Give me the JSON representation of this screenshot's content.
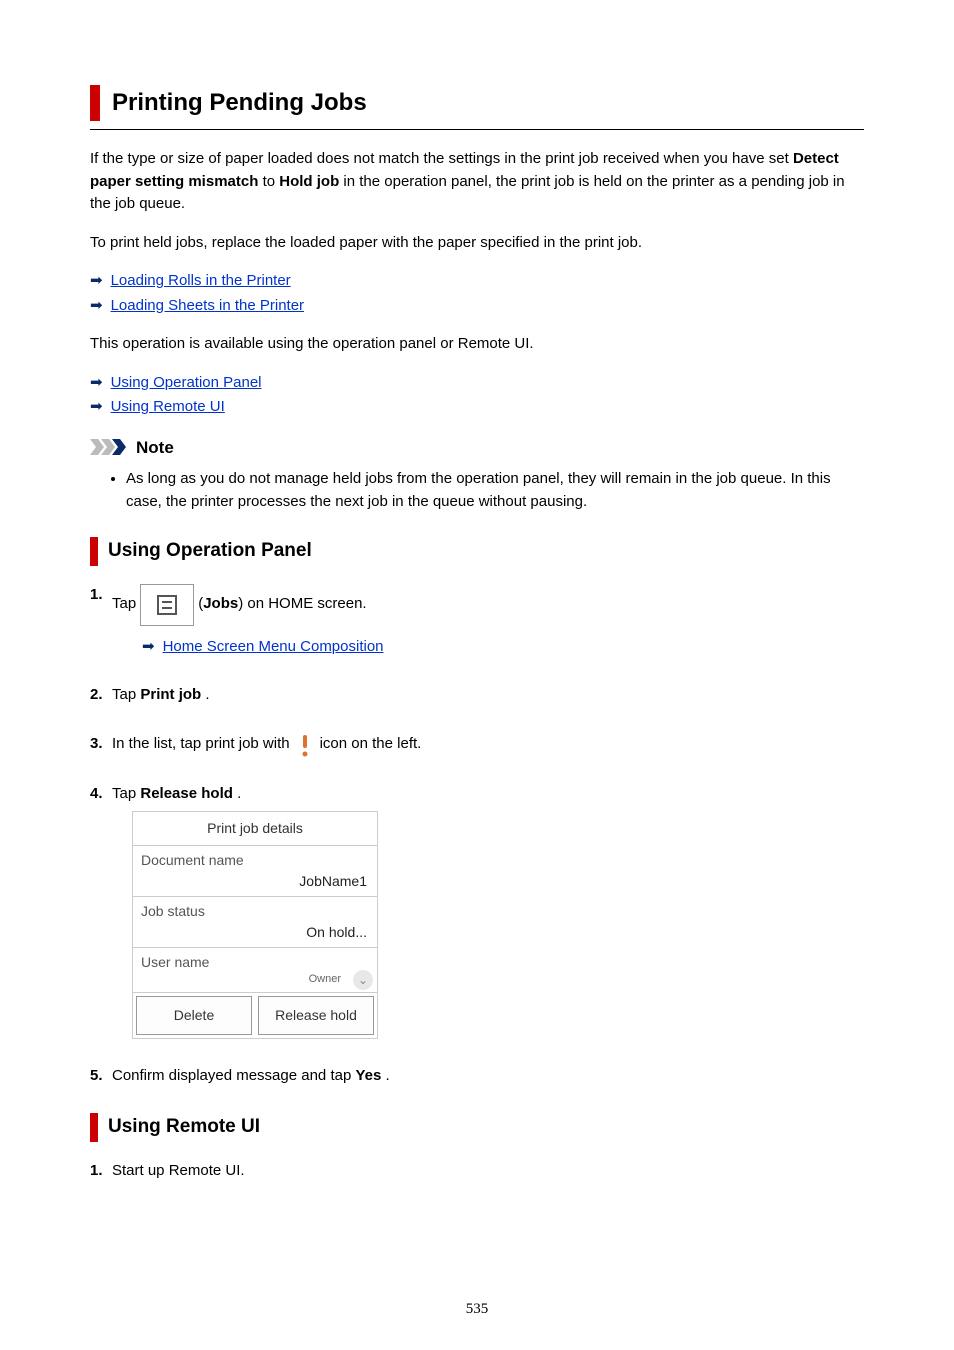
{
  "page": {
    "title": "Printing Pending Jobs",
    "intro_p1_a": "If the type or size of paper loaded does not match the settings in the print job received when you have set ",
    "bold1": "Detect paper setting mismatch",
    "to_word": " to ",
    "bold2": "Hold job",
    "intro_p1_b": " in the operation panel, the print job is held on the printer as a pending job in the job queue.",
    "intro_p2": "To print held jobs, replace the loaded paper with the paper specified in the print job.",
    "links1": {
      "rolls": "Loading Rolls in the Printer",
      "sheets": "Loading Sheets in the Printer"
    },
    "intro_p3": "This operation is available using the operation panel or Remote UI.",
    "links2": {
      "op": "Using Operation Panel",
      "remote": "Using Remote UI"
    },
    "note": {
      "title": "Note",
      "body": "As long as you do not manage held jobs from the operation panel, they will remain in the job queue. In this case, the printer processes the next job in the queue without pausing."
    },
    "h2_op": "Using Operation Panel",
    "steps_op": {
      "s1_a": "Tap ",
      "s1_b": "(",
      "s1_bold": "Jobs",
      "s1_c": ") on HOME screen.",
      "s1_link": "Home Screen Menu Composition",
      "s2_a": "Tap ",
      "s2_bold": "Print job",
      "s2_b": ".",
      "s3_a": "In the list, tap print job with ",
      "s3_b": " icon on the left.",
      "s4_a": "Tap ",
      "s4_bold": "Release hold",
      "s4_b": ".",
      "s5_a": "Confirm displayed message and tap ",
      "s5_bold": "Yes",
      "s5_b": "."
    },
    "panel": {
      "title": "Print job details",
      "docname_label": "Document name",
      "docname_value": "JobName1",
      "jobstatus_label": "Job status",
      "jobstatus_value": "On hold...",
      "username_label": "User name",
      "username_sub": "Owner",
      "delete": "Delete",
      "release": "Release hold"
    },
    "h2_remote": "Using Remote UI",
    "steps_remote": {
      "s1": "Start up Remote UI."
    },
    "pagenum": "535"
  }
}
